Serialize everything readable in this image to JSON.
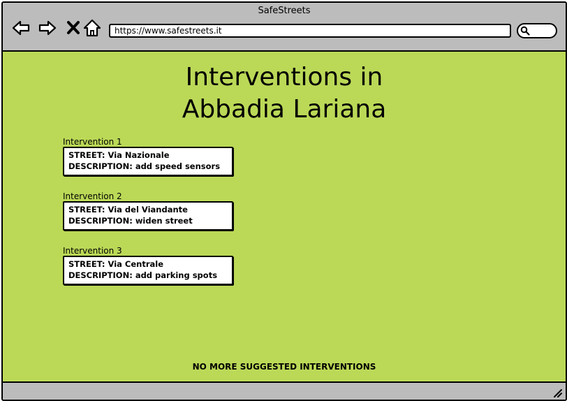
{
  "window": {
    "title": "SafeStreets"
  },
  "toolbar": {
    "back_icon": "back-arrow-icon",
    "forward_icon": "forward-arrow-icon",
    "stop_icon": "close-x-icon",
    "home_icon": "home-icon",
    "url": "https://www.safestreets.it",
    "search_icon": "search-icon"
  },
  "page": {
    "title_line1": "Interventions in",
    "title_line2": "Abbadia Lariana",
    "interventions": [
      {
        "label": "Intervention 1",
        "street": "STREET: Via Nazionale",
        "description": "DESCRIPTION: add speed sensors"
      },
      {
        "label": "Intervention 2",
        "street": "STREET: Via del Viandante",
        "description": "DESCRIPTION: widen street"
      },
      {
        "label": "Intervention 3",
        "street": "STREET: Via Centrale",
        "description": "DESCRIPTION: add parking spots"
      }
    ],
    "footer_note": "NO MORE SUGGESTED INTERVENTIONS"
  },
  "colors": {
    "content_background": "#bbd957",
    "chrome_background": "#bcbcbc"
  }
}
